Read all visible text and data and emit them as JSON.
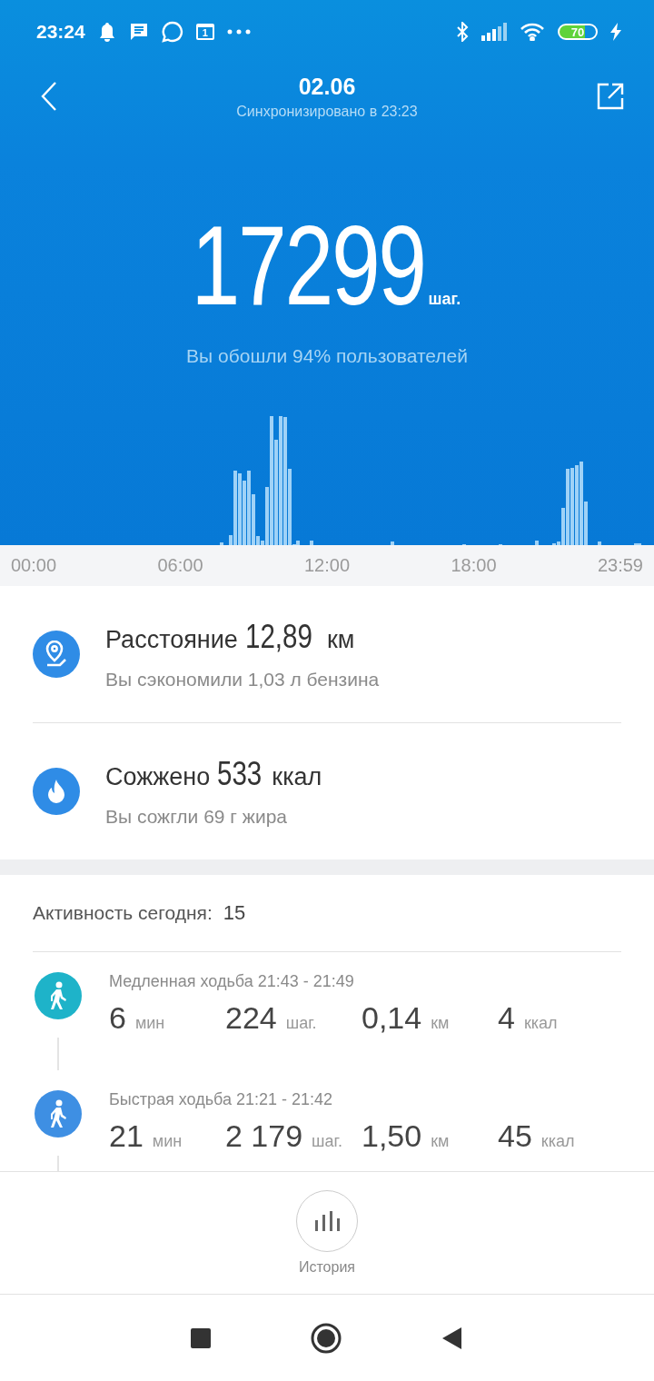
{
  "status_bar": {
    "time": "23:24",
    "calendar_day": "1",
    "battery": "70"
  },
  "header": {
    "title": "02.06",
    "subtitle": "Синхронизировано в 23:23"
  },
  "steps": {
    "value": "17299",
    "unit": "шаг.",
    "comparison": "Вы обошли 94% пользователей"
  },
  "timeline_axis": [
    "00:00",
    "06:00",
    "12:00",
    "18:00",
    "23:59"
  ],
  "summary": [
    {
      "kind": "distance",
      "label": "Расстояние",
      "value": "12,89",
      "unit": "км",
      "note": "Вы сэкономили 1,03 л бензина"
    },
    {
      "kind": "calories",
      "label": "Сожжено",
      "value": "533",
      "unit": "ккал",
      "note": "Вы сожгли 69 г жира"
    }
  ],
  "activity": {
    "label": "Активность сегодня:",
    "count": "15",
    "items": [
      {
        "title": "Медленная ходьба 21:43 - 21:49",
        "color": "#1eb3c9",
        "stats": [
          {
            "value": "6",
            "unit": "мин"
          },
          {
            "value": "224",
            "unit": "шаг."
          },
          {
            "value": "0,14",
            "unit": "км"
          },
          {
            "value": "4",
            "unit": "ккал"
          }
        ]
      },
      {
        "title": "Быстрая ходьба 21:21 - 21:42",
        "color": "#3e8fe3",
        "stats": [
          {
            "value": "21",
            "unit": "мин"
          },
          {
            "value": "2 179",
            "unit": "шаг."
          },
          {
            "value": "1,50",
            "unit": "км"
          },
          {
            "value": "45",
            "unit": "ккал"
          }
        ]
      }
    ]
  },
  "history_button": {
    "label": "История"
  }
}
